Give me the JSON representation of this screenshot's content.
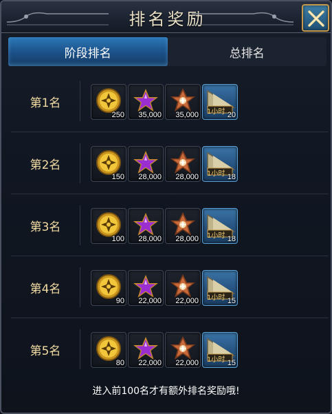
{
  "window": {
    "title": "排名奖励"
  },
  "tabs": [
    {
      "label": "阶段排名",
      "active": true
    },
    {
      "label": "总排名",
      "active": false
    }
  ],
  "ranks": [
    {
      "label": "第1名",
      "rewards": [
        {
          "icon": "gold-coin-icon",
          "qty": "250"
        },
        {
          "icon": "purple-star-icon",
          "qty": "35,000"
        },
        {
          "icon": "bronze-star-medal-icon",
          "qty": "35,000"
        },
        {
          "icon": "hourglass-ticket-icon",
          "qty": "20"
        }
      ]
    },
    {
      "label": "第2名",
      "rewards": [
        {
          "icon": "gold-coin-icon",
          "qty": "150"
        },
        {
          "icon": "purple-star-icon",
          "qty": "28,000"
        },
        {
          "icon": "bronze-star-medal-icon",
          "qty": "28,000"
        },
        {
          "icon": "hourglass-ticket-icon",
          "qty": "18"
        }
      ]
    },
    {
      "label": "第3名",
      "rewards": [
        {
          "icon": "gold-coin-icon",
          "qty": "100"
        },
        {
          "icon": "purple-star-icon",
          "qty": "28,000"
        },
        {
          "icon": "bronze-star-medal-icon",
          "qty": "28,000"
        },
        {
          "icon": "hourglass-ticket-icon",
          "qty": "18"
        }
      ]
    },
    {
      "label": "第4名",
      "rewards": [
        {
          "icon": "gold-coin-icon",
          "qty": "90"
        },
        {
          "icon": "purple-star-icon",
          "qty": "22,000"
        },
        {
          "icon": "bronze-star-medal-icon",
          "qty": "22,000"
        },
        {
          "icon": "hourglass-ticket-icon",
          "qty": "15"
        }
      ]
    },
    {
      "label": "第5名",
      "rewards": [
        {
          "icon": "gold-coin-icon",
          "qty": "80"
        },
        {
          "icon": "purple-star-icon",
          "qty": "22,000"
        },
        {
          "icon": "bronze-star-medal-icon",
          "qty": "22,000"
        },
        {
          "icon": "hourglass-ticket-icon",
          "qty": "15"
        }
      ]
    }
  ],
  "ticket_text": "1小时",
  "footer": {
    "note": "进入前100名才有额外排名奖励哦!"
  },
  "colors": {
    "accent": "#2c78b8",
    "rank_label": "#f1dba2",
    "title": "#e8dfc6",
    "border_gold": "#c59a4a"
  }
}
